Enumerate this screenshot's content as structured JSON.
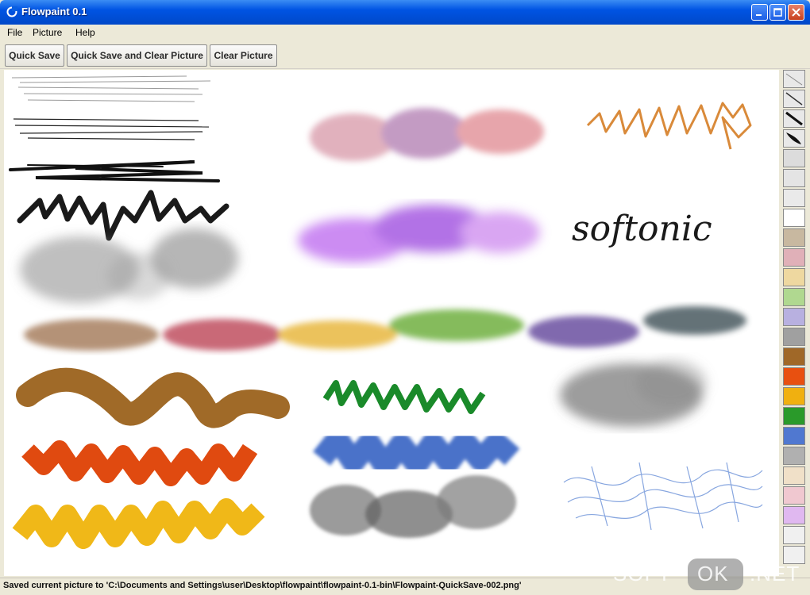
{
  "window": {
    "title": "Flowpaint 0.1",
    "accent": "#0054e3"
  },
  "menu": [
    {
      "label": "File"
    },
    {
      "label": "Picture"
    },
    {
      "label": "Help"
    }
  ],
  "toolbar": {
    "quick_save": "Quick Save",
    "quick_save_clear": "Quick Save and Clear Picture",
    "clear_picture": "Clear Picture"
  },
  "canvas": {
    "handwriting": "softonic",
    "strokes": [
      {
        "name": "thin-gray-lines-stroke",
        "color": "#888888"
      },
      {
        "name": "thin-black-lines-stroke",
        "color": "#222222"
      },
      {
        "name": "black-marker-stroke",
        "color": "#111111"
      },
      {
        "name": "black-zigzag-stroke",
        "color": "#1a1a1a"
      },
      {
        "name": "gray-smudge-stroke",
        "color": "#7a7a7a"
      },
      {
        "name": "pink-purple-crayon-stroke",
        "color": "#c87aa0"
      },
      {
        "name": "orange-pencil-stroke",
        "color": "#d98a3a"
      },
      {
        "name": "violet-airbrush-stroke",
        "color": "#b060e0"
      },
      {
        "name": "multicolor-chalk-stroke",
        "color": "#a88060"
      },
      {
        "name": "brown-wood-stroke",
        "color": "#a06a28"
      },
      {
        "name": "green-zigzag-stroke",
        "color": "#1a8a2a"
      },
      {
        "name": "dark-smudge-stroke",
        "color": "#5a5a5a"
      },
      {
        "name": "red-orange-ribbon-stroke",
        "color": "#e04a10"
      },
      {
        "name": "blue-ribbon-stroke",
        "color": "#2a5ac0"
      },
      {
        "name": "yellow-ribbon-stroke",
        "color": "#f0b818"
      },
      {
        "name": "gray-ribbon-stroke",
        "color": "#707070"
      },
      {
        "name": "blue-thread-stroke",
        "color": "#6a90d8"
      }
    ]
  },
  "palette": {
    "swatches": [
      {
        "name": "thin-pen-swatch",
        "color": "#e8e8e8"
      },
      {
        "name": "medium-pen-swatch",
        "color": "#e8e8e8"
      },
      {
        "name": "thick-pen-swatch",
        "color": "#e8e8e8"
      },
      {
        "name": "leaf-pen-swatch",
        "color": "#e8e8e8"
      },
      {
        "name": "gray-light-swatch",
        "color": "#dcdcdc"
      },
      {
        "name": "gray-lighter-swatch",
        "color": "#e4e4e4"
      },
      {
        "name": "silver-swatch",
        "color": "#eaeaea"
      },
      {
        "name": "white-swatch",
        "color": "#ffffff"
      },
      {
        "name": "tan-swatch",
        "color": "#c8b8a0"
      },
      {
        "name": "pink-swatch",
        "color": "#e0b0b8"
      },
      {
        "name": "cream-swatch",
        "color": "#eed8a0"
      },
      {
        "name": "light-green-swatch",
        "color": "#b0d890"
      },
      {
        "name": "lavender-swatch",
        "color": "#b8b0e0"
      },
      {
        "name": "gray-swatch",
        "color": "#a0a0a0"
      },
      {
        "name": "wood-swatch",
        "color": "#a06828"
      },
      {
        "name": "fire-swatch",
        "color": "#e85010"
      },
      {
        "name": "gold-swatch",
        "color": "#f0b010"
      },
      {
        "name": "leaf-green-swatch",
        "color": "#2a9a2a"
      },
      {
        "name": "blue-swatch",
        "color": "#5078d0"
      },
      {
        "name": "silver-texture-swatch",
        "color": "#b0b0b0"
      },
      {
        "name": "beige-brush-swatch",
        "color": "#f0e0c8"
      },
      {
        "name": "pink-light-swatch",
        "color": "#f0c8d0"
      },
      {
        "name": "violet-light-swatch",
        "color": "#e0b8f0"
      },
      {
        "name": "blank-swatch-a",
        "color": "#f0f0f0"
      },
      {
        "name": "blank-swatch-b",
        "color": "#f0f0f0"
      }
    ]
  },
  "status": {
    "message": "Saved current picture to 'C:\\Documents and Settings\\user\\Desktop\\flowpaint\\flowpaint-0.1-bin\\Flowpaint-QuickSave-002.png'"
  },
  "watermark": {
    "left": "SOFT-",
    "middle": "OK",
    "right": ".NET"
  }
}
